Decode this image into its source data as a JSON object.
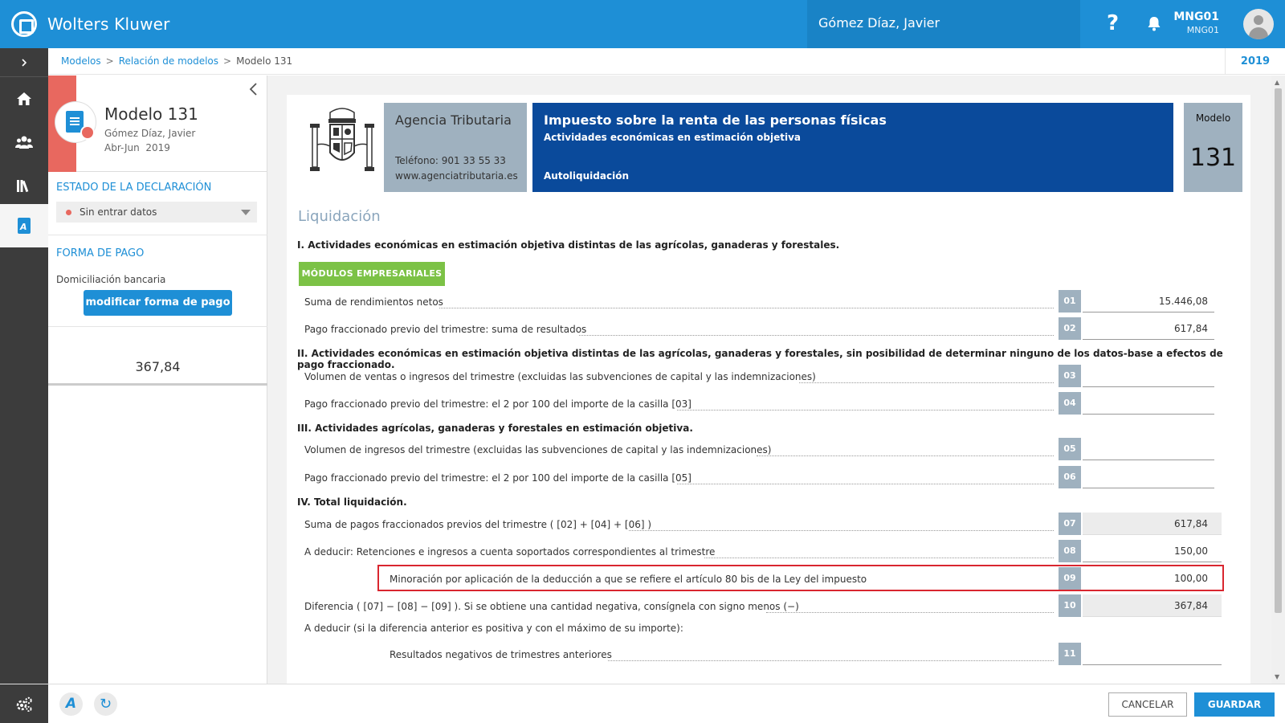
{
  "header": {
    "brand": "Wolters Kluwer",
    "client": "Gómez Díaz, Javier",
    "help": "?",
    "user_code": "MNG01",
    "user_sub": "MNG01"
  },
  "breadcrumb": {
    "items": [
      "Modelos",
      "Relación de modelos"
    ],
    "current": "Modelo 131",
    "year": "2019"
  },
  "sidepanel": {
    "title": "Modelo 131",
    "client": "Gómez Díaz, Javier",
    "period": "Abr-Jun",
    "year": "2019",
    "estado_title": "ESTADO DE LA DECLARACIÓN",
    "estado_value": "Sin entrar datos",
    "pago_title": "FORMA DE PAGO",
    "pago_value": "Domiciliación bancaria",
    "pago_button": "modificar forma de pago",
    "total": "367,84"
  },
  "form": {
    "agency_name": "Agencia Tributaria",
    "agency_tel": "Teléfono: 901 33 55 33",
    "agency_web": "www.agenciatributaria.es",
    "tax_title": "Impuesto sobre la renta de las personas físicas",
    "tax_subtitle": "Actividades económicas en estimación objetiva",
    "tax_type": "Autoliquidación",
    "modelo_label": "Modelo",
    "modelo_number": "131",
    "liquidacion": "Liquidación",
    "sec1": "I. Actividades económicas en estimación objetiva distintas de las agrícolas, ganaderas y forestales.",
    "modulos_button": "MÓDULOS EMPRESARIALES",
    "sec2": "II. Actividades económicas en estimación objetiva distintas de las agrícolas, ganaderas y forestales, sin posibilidad de determinar ninguno de los datos-base a efectos de pago fraccionado.",
    "sec3": "III. Actividades agrícolas, ganaderas y forestales en estimación objetiva.",
    "sec4": "IV. Total liquidación.",
    "deducir_text": "A deducir (si la diferencia anterior es positiva y con el máximo de su importe):",
    "rows": [
      {
        "code": "01",
        "label": "Suma de rendimientos netos",
        "value": "15.446,08"
      },
      {
        "code": "02",
        "label": "Pago fraccionado previo del trimestre: suma de resultados",
        "value": "617,84"
      },
      {
        "code": "03",
        "label": "Volumen de ventas o ingresos del trimestre (excluidas las subvenciones de capital y las indemnizaciones)",
        "value": ""
      },
      {
        "code": "04",
        "label": "Pago fraccionado previo del trimestre: el 2 por 100 del importe de la casilla [03]",
        "value": ""
      },
      {
        "code": "05",
        "label": "Volumen de ingresos del trimestre (excluidas las subvenciones de capital y las indemnizaciones)",
        "value": ""
      },
      {
        "code": "06",
        "label": "Pago fraccionado previo del trimestre: el 2 por 100 del importe de la casilla [05]",
        "value": ""
      },
      {
        "code": "07",
        "label": "Suma de pagos fraccionados previos del trimestre ( [02] + [04] + [06] )",
        "value": "617,84"
      },
      {
        "code": "08",
        "label": "A deducir: Retenciones e ingresos a cuenta soportados correspondientes al trimestre",
        "value": "150,00"
      },
      {
        "code": "09",
        "label": "Minoración por aplicación de la deducción a que se refiere el artículo 80 bis de la Ley del impuesto",
        "value": "100,00"
      },
      {
        "code": "10",
        "label": "Diferencia ( [07] − [08] − [09] ). Si se obtiene una cantidad negativa, consígnela con signo menos (−)",
        "value": "367,84"
      },
      {
        "code": "11",
        "label": "Resultados negativos de trimestres anteriores",
        "value": ""
      }
    ]
  },
  "footer": {
    "cancel": "CANCELAR",
    "save": "GUARDAR"
  },
  "colors": {
    "topbar": "#1e8fd6",
    "nav": "#3c3c3c",
    "tax_header": "#0a4a9b",
    "agency_box": "#9fb1bf",
    "green": "#7cc246",
    "highlight": "#d9262f",
    "status_dot": "#e8685f"
  }
}
